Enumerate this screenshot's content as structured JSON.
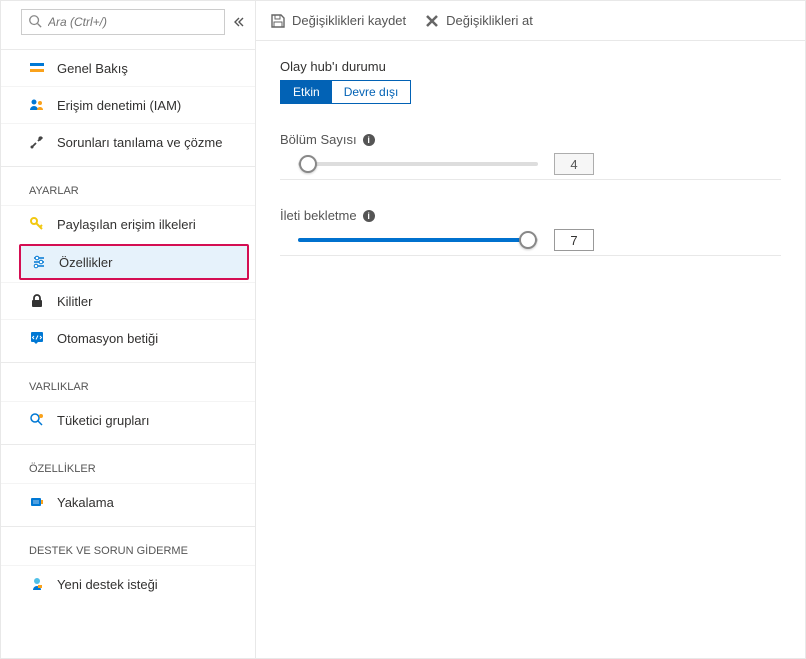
{
  "search": {
    "placeholder": "Ara (Ctrl+/)"
  },
  "nav": {
    "overview": "Genel Bakış",
    "iam": "Erişim denetimi (IAM)",
    "diagnose": "Sorunları tanılama ve çözme"
  },
  "sections": {
    "settings": "AYARLAR",
    "entities": "VARLIKLAR",
    "features": "ÖZELLİKLER",
    "support": "DESTEK VE SORUN GİDERME"
  },
  "settings_items": {
    "sap": "Paylaşılan erişim ilkeleri",
    "properties": "Özellikler",
    "locks": "Kilitler",
    "automation": "Otomasyon betiği"
  },
  "entities_items": {
    "consumer": "Tüketici grupları"
  },
  "features_items": {
    "capture": "Yakalama"
  },
  "support_items": {
    "newrequest": "Yeni destek isteği"
  },
  "toolbar": {
    "save": "Değişiklikleri kaydet",
    "discard": "Değişiklikleri at"
  },
  "status": {
    "label": "Olay hub'ı durumu",
    "active": "Etkin",
    "disabled": "Devre dışı"
  },
  "partition": {
    "label": "Bölüm Sayısı",
    "value": "4"
  },
  "retention": {
    "label": "İleti bekletme",
    "value": "7"
  }
}
